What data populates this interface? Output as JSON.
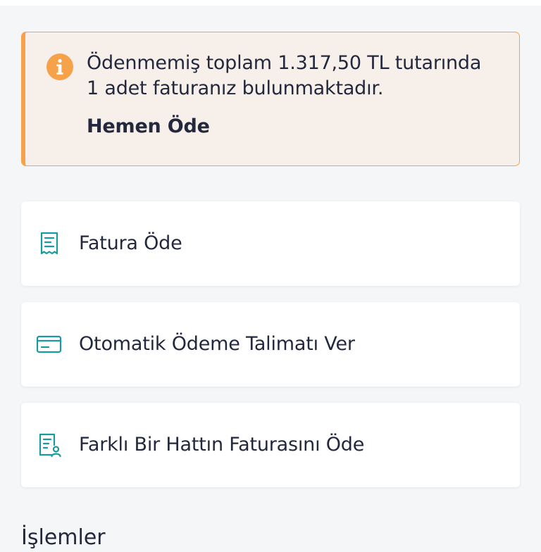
{
  "alert": {
    "icon": "info-icon",
    "message_line1": "Ödenmemiş toplam 1.317,50 TL tutarında",
    "message_line2": "1 adet faturanız bulunmaktadır.",
    "action_label": "Hemen Öde",
    "accent_color": "#f6a24a",
    "background_color": "#f6efea"
  },
  "actions": [
    {
      "label": "Fatura Öde",
      "icon": "receipt-icon"
    },
    {
      "label": "Otomatik Ödeme Talimatı Ver",
      "icon": "credit-card-icon"
    },
    {
      "label": "Farklı Bir Hattın Faturasını Öde",
      "icon": "receipt-user-icon"
    }
  ],
  "section": {
    "title": "İşlemler"
  },
  "colors": {
    "icon_teal": "#1a9a9a",
    "text": "#23283d",
    "page_background": "#f5f6f8"
  }
}
